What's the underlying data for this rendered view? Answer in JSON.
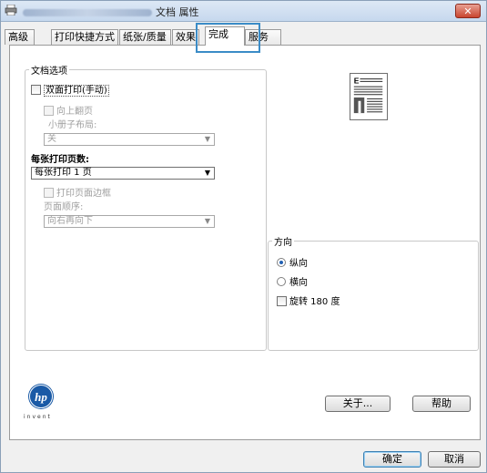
{
  "window": {
    "title": "文档 属性",
    "close_label": "✕"
  },
  "tabs": [
    {
      "label": "高级"
    },
    {
      "label": "打印快捷方式"
    },
    {
      "label": "纸张/质量"
    },
    {
      "label": "效果"
    },
    {
      "label": "完成"
    },
    {
      "label": "服务"
    }
  ],
  "document_options": {
    "legend": "文档选项",
    "duplex_label": "双面打印(手动)",
    "flip_pages_up_label": "向上翻页",
    "booklet_layout_label": "小册子布局:",
    "booklet_layout_value": "关",
    "pages_per_sheet_label": "每张打印页数:",
    "pages_per_sheet_value": "每张打印 1 页",
    "print_page_borders_label": "打印页面边框",
    "page_order_label": "页面顺序:",
    "page_order_value": "向右再向下"
  },
  "orientation": {
    "legend": "方向",
    "portrait_label": "纵向",
    "landscape_label": "横向",
    "rotate_label": "旋转 180 度",
    "selected": "portrait"
  },
  "buttons": {
    "about": "关于...",
    "help": "帮助",
    "ok": "确定",
    "cancel": "取消"
  },
  "logo": {
    "text": "invent",
    "icon": "hp-logo"
  },
  "colors": {
    "accent": "#3b8cc7",
    "title_bar": "#c6d8ee",
    "close": "#c9452f"
  }
}
